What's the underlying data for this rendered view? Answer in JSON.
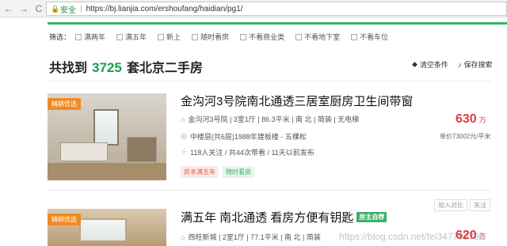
{
  "browser": {
    "back_glyph": "←",
    "forward_glyph": "→",
    "reload_glyph": "C",
    "home_glyph": "⌂",
    "lock_glyph": "🔒",
    "secure_label": "安全",
    "separator": "|",
    "url": "https://bj.lianjia.com/ershoufang/haidian/pg1/"
  },
  "filters": {
    "label": "筛选：",
    "items": [
      "满两年",
      "满五年",
      "新上",
      "随时看房",
      "不看商业类",
      "不看地下室",
      "不看车位"
    ]
  },
  "heading": {
    "prefix": "共找到",
    "count": "3725",
    "suffix": "套北京二手房"
  },
  "tools": {
    "clear_label": "清空条件",
    "save_label": "保存搜索"
  },
  "listings": [
    {
      "badge": "精耕优选",
      "title": "金沟河3号院南北通透三居室厨房卫生间带窗",
      "house_info": "金沟河3号院 | 3室1厅 | 86.3平米 | 南 北 | 简装 | 无电梯",
      "position_info": "中楼层(共6层)1988年建板楼 - 五棵松",
      "follow_info": "118人关注 / 共44次带看 / 11天以前发布",
      "tags": [
        "房本满五年",
        "随时看房"
      ],
      "price": "630",
      "price_unit": "万",
      "unit_price": "单价73002元/平米"
    },
    {
      "badge": "精耕优选",
      "title": "满五年 南北通透 看房方便有钥匙",
      "title_tag": "房主自荐",
      "house_info": "西旺新城 | 2室1厅 | 77.1平米 | 南 北 | 简装",
      "price": "620",
      "price_unit": "万",
      "actions": [
        "加入对比",
        "关注"
      ]
    }
  ],
  "watermark": "https://blog.csdn.net/fei347795790",
  "colors": {
    "accent_green": "#37b36f",
    "price_red": "#e4393c",
    "badge_orange": "#f08a24"
  }
}
